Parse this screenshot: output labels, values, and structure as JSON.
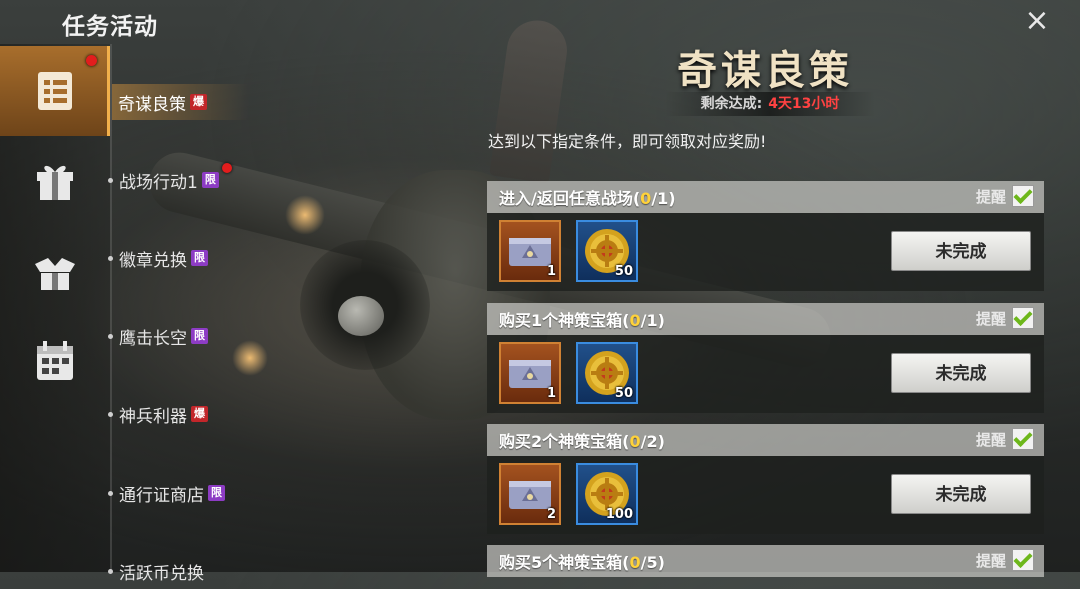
{
  "header": {
    "title": "任务活动",
    "close_icon": "×"
  },
  "sidebar": {
    "icons": [
      {
        "name": "task-list-icon",
        "active": true,
        "dot": true
      },
      {
        "name": "gift-box-icon",
        "active": false,
        "dot": false
      },
      {
        "name": "open-gift-icon",
        "active": false,
        "dot": false
      },
      {
        "name": "calendar-icon",
        "active": false,
        "dot": false
      }
    ],
    "items": [
      {
        "label": "奇谋良策",
        "badge": "爆",
        "active": true
      },
      {
        "label": "战场行动1",
        "badge": "限",
        "active": false
      },
      {
        "label": "徽章兑换",
        "badge": "限",
        "active": false
      },
      {
        "label": "鹰击长空",
        "badge": "限",
        "active": false
      },
      {
        "label": "神兵利器",
        "badge": "爆",
        "active": false
      },
      {
        "label": "通行证商店",
        "badge": "限",
        "active": false
      },
      {
        "label": "活跃币兑换",
        "badge": "",
        "active": false
      }
    ]
  },
  "event": {
    "title": "奇谋良策",
    "remaining_label": "剩余达成:",
    "remaining_value": "4天13小时",
    "instruction": "达到以下指定条件，即可领取对应奖励!"
  },
  "tasks": [
    {
      "name": "进入/返回任意战场",
      "done": "0",
      "total": "/1",
      "remind_label": "提醒",
      "rewards": [
        {
          "type": "chest",
          "qty": "1"
        },
        {
          "type": "coin",
          "qty": "50"
        }
      ],
      "status": "未完成"
    },
    {
      "name": "购买1个神策宝箱",
      "done": "0",
      "total": "/1",
      "remind_label": "提醒",
      "rewards": [
        {
          "type": "chest",
          "qty": "1"
        },
        {
          "type": "coin",
          "qty": "50"
        }
      ],
      "status": "未完成"
    },
    {
      "name": "购买2个神策宝箱",
      "done": "0",
      "total": "/2",
      "remind_label": "提醒",
      "rewards": [
        {
          "type": "chest",
          "qty": "2"
        },
        {
          "type": "coin",
          "qty": "100"
        }
      ],
      "status": "未完成"
    },
    {
      "name": "购买5个神策宝箱",
      "done": "0",
      "total": "/5",
      "remind_label": "提醒",
      "rewards": [],
      "status": ""
    }
  ],
  "colors": {
    "accent": "#a86e2c",
    "progress_done": "#ffd23a",
    "remaining": "#ff4242",
    "badge_bao": "#c2262a",
    "badge_xian": "#8d3cc4"
  }
}
